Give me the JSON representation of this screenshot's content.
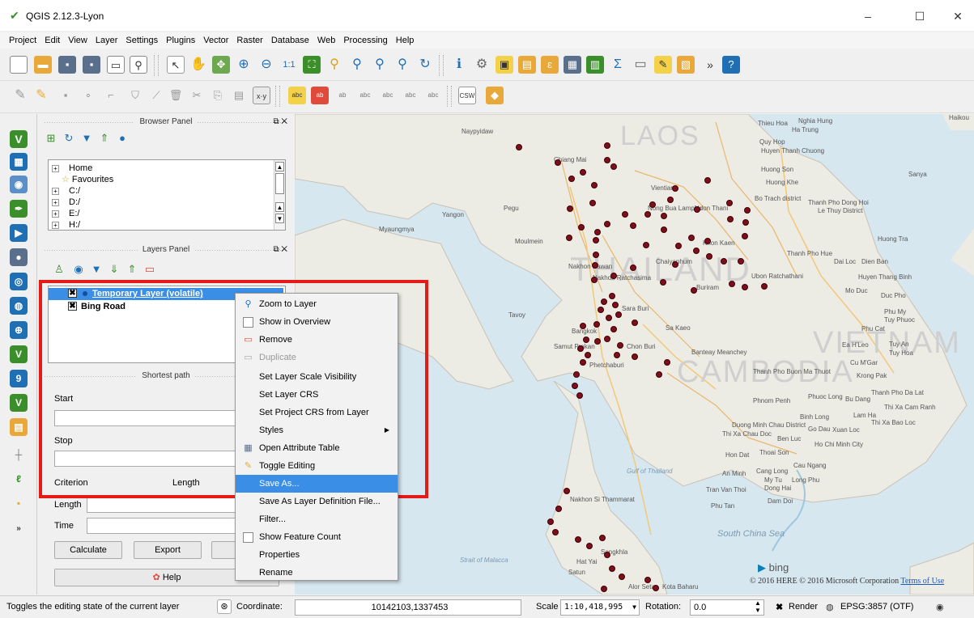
{
  "window": {
    "title": "QGIS 2.12.3-Lyon",
    "minimize": "–",
    "maximize": "☐",
    "close": "✕"
  },
  "menu": [
    "Project",
    "Edit",
    "View",
    "Layer",
    "Settings",
    "Plugins",
    "Vector",
    "Raster",
    "Database",
    "Web",
    "Processing",
    "Help"
  ],
  "toolbar_more": "»",
  "browser_panel": {
    "title": "Browser Panel",
    "items": [
      "Home",
      "Favourites",
      "C:/",
      "D:/",
      "E:/",
      "H:/"
    ]
  },
  "layers_panel": {
    "title": "Layers Panel",
    "layers": [
      {
        "name": "Temporary Layer (volatile)",
        "selected": true
      },
      {
        "name": "Bing Road",
        "selected": false
      }
    ]
  },
  "shortest_path": {
    "title": "Shortest path",
    "start_label": "Start",
    "stop_label": "Stop",
    "criterion_label": "Criterion",
    "criterion_value": "Length",
    "length_label": "Length",
    "time_label": "Time",
    "calculate": "Calculate",
    "export": "Export",
    "help": "Help"
  },
  "context_menu": [
    {
      "label": "Zoom to Layer",
      "icon": "zoom-icon"
    },
    {
      "label": "Show in Overview",
      "icon": "checkbox-icon"
    },
    {
      "label": "Remove",
      "icon": "remove-icon"
    },
    {
      "label": "Duplicate",
      "icon": "duplicate-icon",
      "disabled": true
    },
    {
      "label": "Set Layer Scale Visibility"
    },
    {
      "label": "Set Layer CRS"
    },
    {
      "label": "Set Project CRS from Layer"
    },
    {
      "label": "Styles",
      "submenu": true
    },
    {
      "label": "Open Attribute Table",
      "icon": "table-icon"
    },
    {
      "label": "Toggle Editing",
      "icon": "pencil-icon"
    },
    {
      "label": "Save As...",
      "selected": true
    },
    {
      "label": "Save As Layer Definition File..."
    },
    {
      "label": "Filter..."
    },
    {
      "label": "Show Feature Count",
      "icon": "checkbox-icon"
    },
    {
      "label": "Properties"
    },
    {
      "label": "Rename"
    }
  ],
  "map": {
    "country_labels": [
      "LAOS",
      "THAILAND",
      "CAMBODIA",
      "VIETNAM"
    ],
    "place_labels": [
      "Naypyidaw",
      "Chiang Mai",
      "Vientiane",
      "Nong Bua Lamphu",
      "Udon Thani",
      "Yangon",
      "Myaungmya",
      "Moulmein",
      "Pegu",
      "Khon Kaen",
      "Nakhon Sawan",
      "Chaiyaphum",
      "Nakhon Ratchasima",
      "Buriram",
      "Ubon Ratchathani",
      "Sara Buri",
      "Tavoy",
      "Bangkok",
      "Samut Prakan",
      "Chon Buri",
      "Sa Kaeo",
      "Phetchaburi",
      "Banteay Meanchey",
      "Thieu Hoa",
      "Nghia Hung",
      "Ha Trung",
      "Quy Hop",
      "Huyen Thanh Chuong",
      "Huong Son",
      "Huong Khe",
      "Bo Trach district",
      "Thanh Pho Dong Hoi",
      "Le Thuy District",
      "Sanya",
      "Huong Tra",
      "Thanh Pho Hue",
      "Dai Loc",
      "Dien Ban",
      "Huyen Thang Binh",
      "Mo Duc",
      "Duc Pho",
      "Phu My",
      "Tuy Phuoc",
      "Phu Cat",
      "Ea H'Leo",
      "Tuy An",
      "Tuy Hoa",
      "Cu M'Gar",
      "Krong Pak",
      "Thanh Pho Buon Ma Thuot",
      "Phuoc Long",
      "Bu Dang",
      "Thanh Pho Da Lat",
      "Thi Xa Cam Ranh",
      "Phnom Penh",
      "Lam Ha",
      "Binh Long",
      "Thi Xa Bao Loc",
      "Duong Minh Chau District",
      "Go Dau",
      "Xuan Loc",
      "Thi Xa Chau Doc",
      "Ben Luc",
      "Ho Chi Minh City",
      "Hon Dat",
      "Thoai Son",
      "An Minh",
      "Cang Long",
      "Cau Ngang",
      "My Tu",
      "Long Phu",
      "Dong Hai",
      "Tran Van Thoi",
      "Dam Doi",
      "Phu Tan",
      "Gulf of Thailand",
      "South China Sea",
      "Nakhon Si Thammarat",
      "Songkhla",
      "Hat Yai",
      "Satun",
      "Alor Setar",
      "Kota Baharu",
      "Strait of Malacca",
      "Haikou"
    ],
    "bing_label": "bing",
    "copyright": "© 2016 HERE © 2016 Microsoft Corporation",
    "terms": "Terms of Use"
  },
  "statusbar": {
    "message": "Toggles the editing state of the current layer",
    "coordinate_label": "Coordinate:",
    "coordinate": "10142103,1337453",
    "scale_label": "Scale",
    "scale": "1:10,418,995",
    "rotation_label": "Rotation:",
    "rotation": "0.0",
    "render_label": "Render",
    "crs": "EPSG:3857 (OTF)"
  }
}
